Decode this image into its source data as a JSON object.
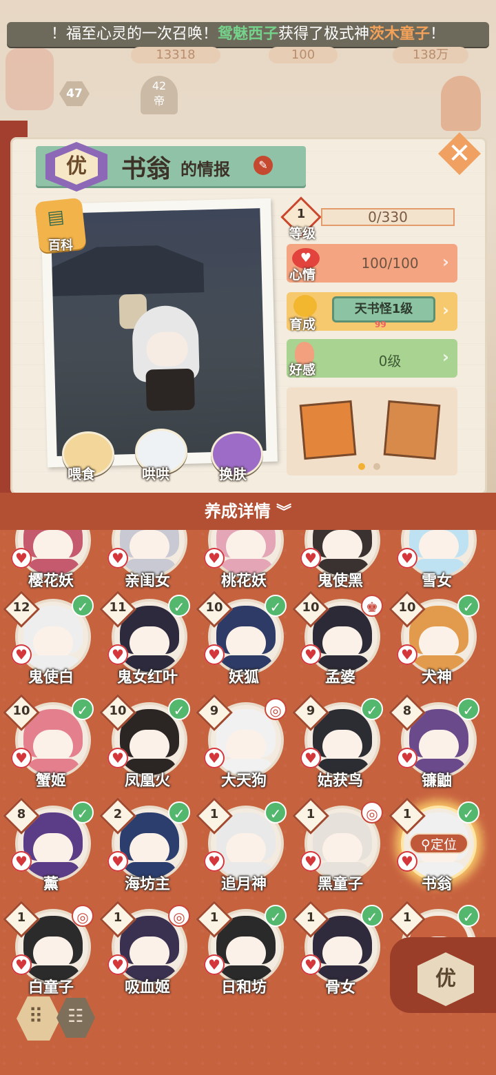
{
  "banner": {
    "prefix": "！福至心灵的一次召唤！",
    "player": "鸳魅西子",
    "middle": "获得了极式神",
    "shikigami": "茨木童子",
    "suffix": "！"
  },
  "resources": [
    "13318",
    "100",
    "138万"
  ],
  "player_level": "47",
  "event_counter": "42",
  "event_counter_unit": "帝",
  "info": {
    "grade": "优",
    "name": "书翁",
    "name_suffix": "的情报",
    "wiki_label": "百科",
    "actions": [
      "喂食",
      "哄哄",
      "换肤"
    ],
    "level": "1",
    "level_label": "等级",
    "exp": "0/330",
    "mood_label": "心情",
    "mood_value": "100/100",
    "growth_label": "育成",
    "growth_value": "天书怪1级",
    "growth_sub": "99",
    "affinity_label": "好感",
    "affinity_value": "0级"
  },
  "details_bar": "养成详情",
  "grid_cells": [
    {
      "name": "樱花妖",
      "level": "",
      "badge": "red",
      "hair": "#c55a6e"
    },
    {
      "name": "亲闺女",
      "level": "",
      "badge": "",
      "hair": "#c8c9d3"
    },
    {
      "name": "桃花妖",
      "level": "",
      "badge": "",
      "hair": "#e4a6b6"
    },
    {
      "name": "鬼使黑",
      "level": "",
      "badge": "",
      "hair": "#3a3230"
    },
    {
      "name": "雪女",
      "level": "",
      "badge": "",
      "hair": "#bfe2f2"
    },
    {
      "name": "鬼使白",
      "level": "12",
      "badge": "check",
      "hair": "#eeeeee"
    },
    {
      "name": "鬼女红叶",
      "level": "11",
      "badge": "check",
      "hair": "#2d2a3e"
    },
    {
      "name": "妖狐",
      "level": "10",
      "badge": "check",
      "hair": "#2e3b66"
    },
    {
      "name": "孟婆",
      "level": "10",
      "badge": "hat",
      "hair": "#2b2a36"
    },
    {
      "name": "犬神",
      "level": "10",
      "badge": "check",
      "hair": "#e29a4c"
    },
    {
      "name": "蟹姬",
      "level": "10",
      "badge": "check",
      "hair": "#e47f8e"
    },
    {
      "name": "凤凰火",
      "level": "10",
      "badge": "check",
      "hair": "#2b2624"
    },
    {
      "name": "大天狗",
      "level": "9",
      "badge": "spiral",
      "hair": "#f1f1f1"
    },
    {
      "name": "姑获鸟",
      "level": "9",
      "badge": "check",
      "hair": "#2c2c33"
    },
    {
      "name": "镰鼬",
      "level": "8",
      "badge": "check",
      "hair": "#6b4a8c"
    },
    {
      "name": "薰",
      "level": "8",
      "badge": "check",
      "hair": "#5b3c86"
    },
    {
      "name": "海坊主",
      "level": "2",
      "badge": "check",
      "hair": "#2c3e6e"
    },
    {
      "name": "追月神",
      "level": "1",
      "badge": "check",
      "hair": "#e9e9e9"
    },
    {
      "name": "黑童子",
      "level": "1",
      "badge": "spiral",
      "hair": "#e7e1dc"
    },
    {
      "name": "书翁",
      "level": "1",
      "badge": "check",
      "hair": "#f0f0f0",
      "selected": true,
      "tag": "定位"
    },
    {
      "name": "白童子",
      "level": "1",
      "badge": "spiral",
      "hair": "#2b2b2b"
    },
    {
      "name": "吸血姬",
      "level": "1",
      "badge": "spiral",
      "hair": "#3a3050"
    },
    {
      "name": "日和坊",
      "level": "1",
      "badge": "check",
      "hair": "#2a2a2a"
    },
    {
      "name": "骨女",
      "level": "1",
      "badge": "check",
      "hair": "#2f2a3c"
    },
    {
      "name": "",
      "level": "1",
      "badge": "check",
      "hair": "#c7613e"
    }
  ],
  "filter_label": "优",
  "colors": {
    "accent_red": "#b34f33",
    "panel_green": "#8fc2a7",
    "check_green": "#53b86d",
    "mood_bg": "#f4a481",
    "growth_bg": "#f6c96e",
    "affinity_bg": "#a9d391"
  },
  "icons": [
    "close-icon",
    "edit-icon",
    "wiki-icon",
    "heart-icon",
    "check-icon",
    "spiral-icon",
    "chevron-right-icon",
    "chevron-double-down-icon",
    "grid-view-icon",
    "list-view-icon"
  ]
}
